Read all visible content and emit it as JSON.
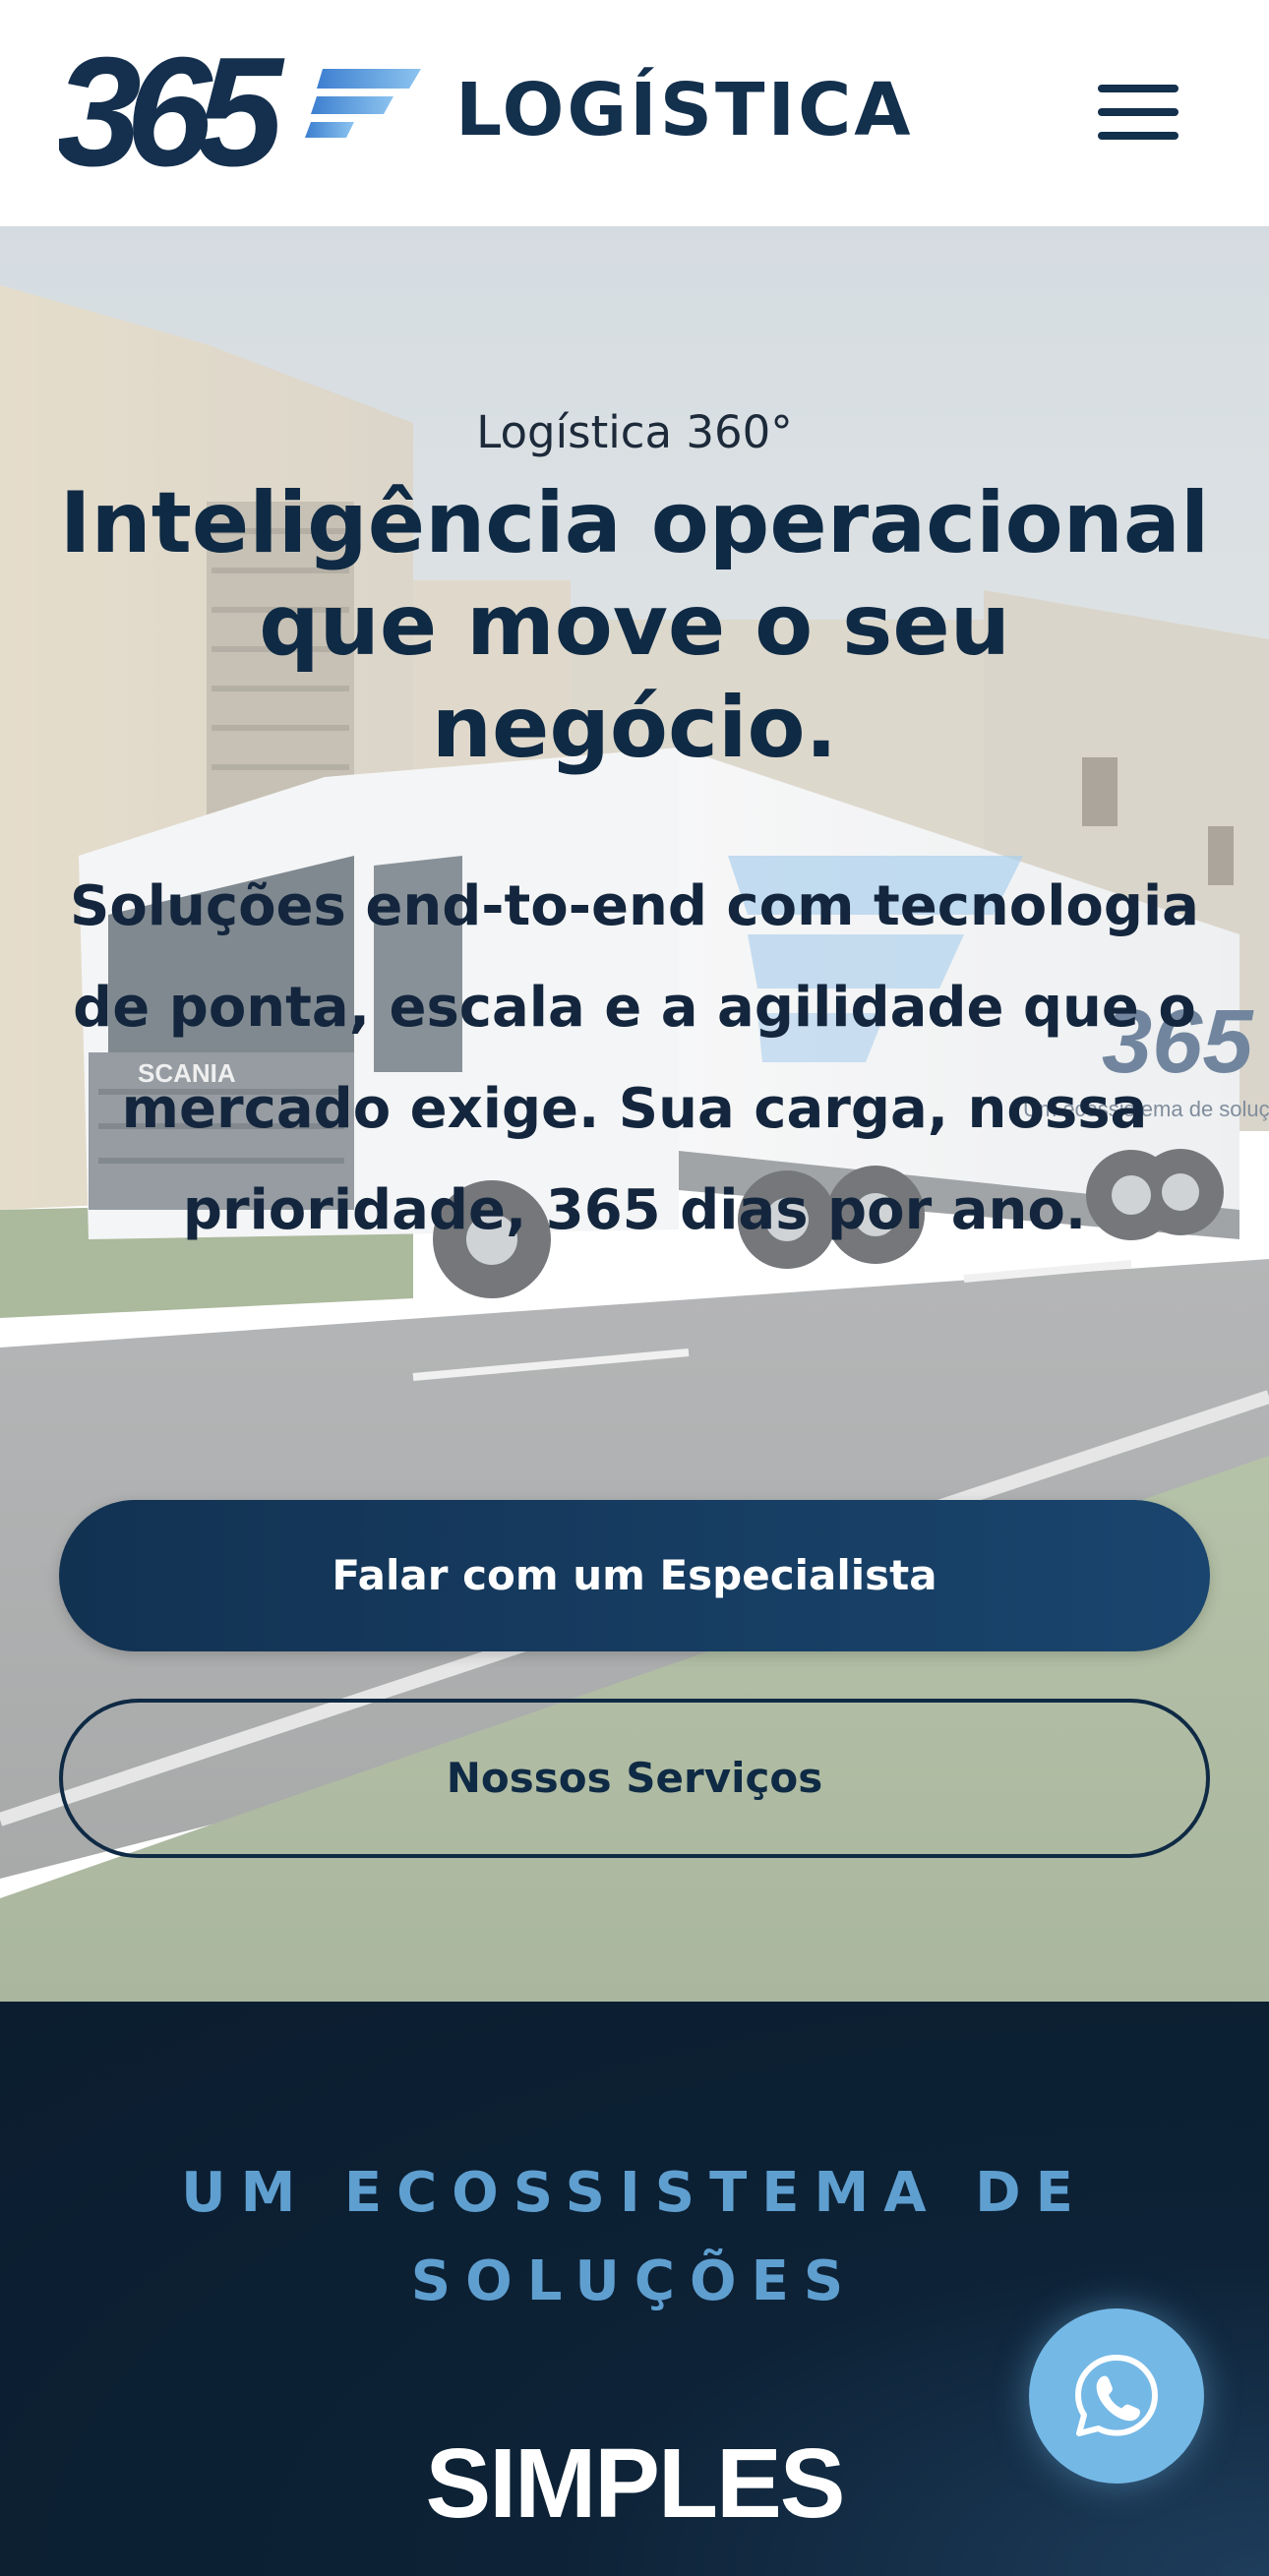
{
  "header": {
    "logo_text": "365",
    "brand": "LOGÍSTICA",
    "menu_icon": "hamburger-menu-icon"
  },
  "hero": {
    "eyebrow": "Logística 360°",
    "title": "Inteligência operacional que move o seu negócio.",
    "subtitle": "Soluções end-to-end com tecnologia de ponta, escala e a agilidade que o mercado exige. Sua carga, nossa prioridade, 365 dias por ano.",
    "primary_button": "Falar com um Especialista",
    "secondary_button": "Nossos Serviços",
    "image_trailer_logo": "365",
    "image_trailer_tagline": "Um ecossistema de soluções logísticas",
    "image_truck_brand": "SCANIA"
  },
  "ecosystem": {
    "kicker": "UM ECOSSISTEMA DE SOLUÇÕES",
    "word": "SIMPLES"
  },
  "whatsapp": {
    "icon": "whatsapp-icon"
  },
  "colors": {
    "brand_navy": "#13304d",
    "accent_blue": "#5f9fd0",
    "fab_blue": "#74b8e6",
    "dark_section": "#0b1d2f"
  }
}
